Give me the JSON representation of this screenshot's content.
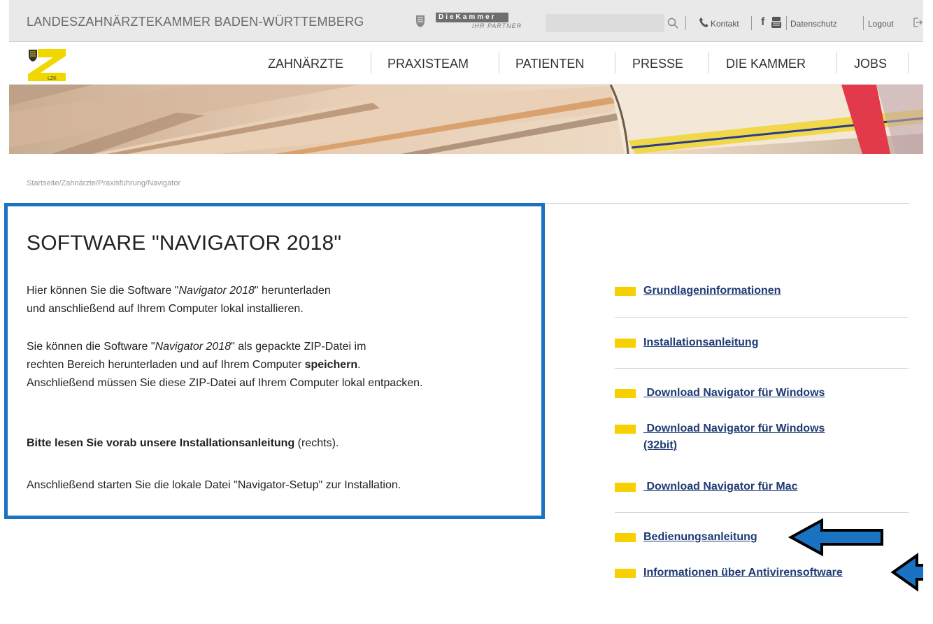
{
  "topbar": {
    "org_title": "LANDESZAHNÄRZTEKAMMER BADEN-WÜRTTEMBERG",
    "kammer_logo_main": "DieKammer",
    "kammer_logo_sub": "IHR PARTNER",
    "search_placeholder": "",
    "links": {
      "kontakt": "Kontakt",
      "datenschutz": "Datenschutz",
      "logout": "Logout"
    },
    "icons": [
      "crest-icon",
      "search-icon",
      "phone-icon",
      "facebook-icon",
      "youtube-icon",
      "logout-icon"
    ]
  },
  "nav": {
    "logo_text": "LZK",
    "items": [
      "ZAHNÄRZTE",
      "PRAXISTEAM",
      "PATIENTEN",
      "PRESSE",
      "DIE KAMMER",
      "JOBS"
    ]
  },
  "breadcrumb": "Startseite/Zahnärzte/Praxisführung/Navigator",
  "main": {
    "title": "SOFTWARE \"NAVIGATOR 2018\"",
    "p1": {
      "line1_a": "Hier können Sie die Software \"",
      "line1_em": "Navigator 2018",
      "line1_b": "\" herunterladen",
      "line2": "und anschließend auf Ihrem Computer lokal installieren."
    },
    "p2": {
      "line1_a": "Sie können die Software \"",
      "line1_em": "Navigator 2018",
      "line1_b": "\" als gepackte ZIP-Datei im",
      "line2_a": "rechten Bereich herunterladen und auf Ihrem Computer ",
      "line2_bold": "speichern",
      "line2_b": ".",
      "line3": "Anschließend müssen Sie diese ZIP-Datei auf Ihrem Computer lokal entpacken."
    },
    "p3": {
      "bold": "Bitte lesen Sie vorab unsere Installationsanleitung",
      "rest": " (rechts)."
    },
    "p4": "Anschließend starten Sie die lokale Datei \"Navigator-Setup\" zur Installation."
  },
  "sidebar": {
    "links": [
      "Grundlageninformationen",
      "Installationsanleitung",
      " Download Navigator für Windows",
      " Download Navigator für Windows",
      "(32bit)",
      " Download Navigator für Mac",
      "Bedienungsanleitung",
      "Informationen über Antivirensoftware"
    ]
  },
  "colors": {
    "accent_yellow": "#f7d000",
    "link": "#1f3b73",
    "highlight_blue": "#1a72c2"
  }
}
